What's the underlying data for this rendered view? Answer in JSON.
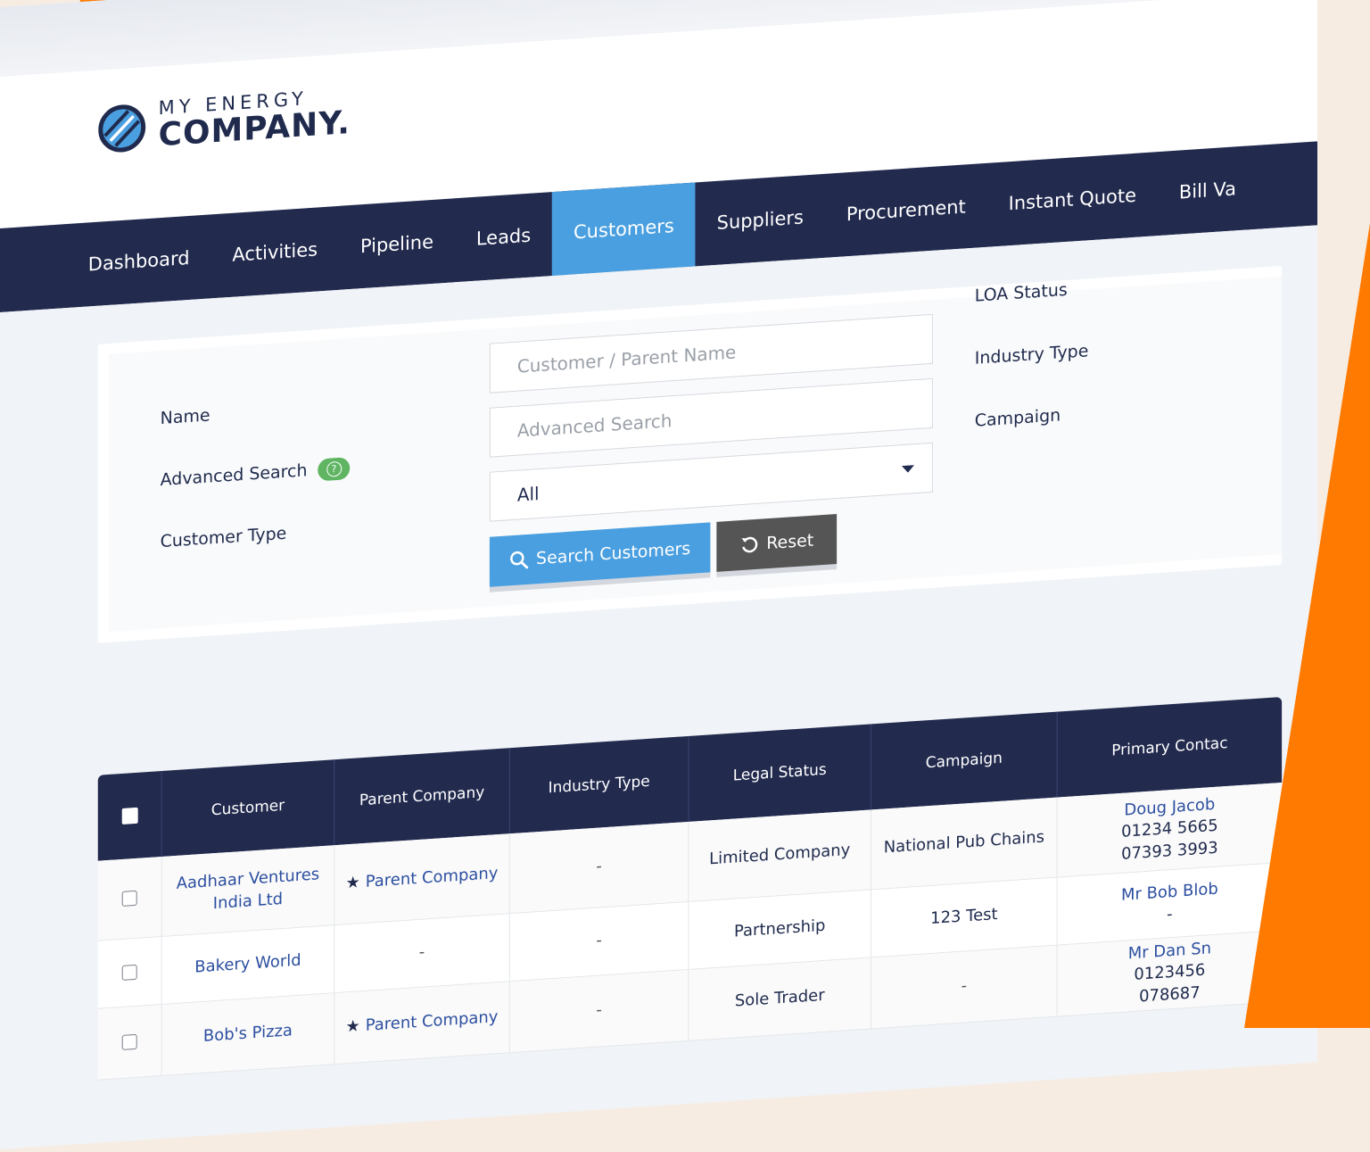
{
  "logo": {
    "small": "MY ENERGY",
    "big": "COMPANY."
  },
  "nav": {
    "items": [
      {
        "label": "Dashboard"
      },
      {
        "label": "Activities"
      },
      {
        "label": "Pipeline"
      },
      {
        "label": "Leads"
      },
      {
        "label": "Customers",
        "active": true
      },
      {
        "label": "Suppliers"
      },
      {
        "label": "Procurement"
      },
      {
        "label": "Instant Quote"
      },
      {
        "label": "Bill Va"
      }
    ]
  },
  "filter": {
    "name_label": "Name",
    "advanced_label": "Advanced Search",
    "customer_type_label": "Customer Type",
    "name_placeholder": "Customer / Parent Name",
    "advanced_placeholder": "Advanced Search",
    "customer_type_value": "All",
    "loa_status_label": "LOA Status",
    "industry_type_label": "Industry Type",
    "campaign_label": "Campaign",
    "search_button": "Search Customers",
    "reset_button": "Reset"
  },
  "table": {
    "headers": [
      "Customer",
      "Parent Company",
      "Industry Type",
      "Legal Status",
      "Campaign",
      "Primary Contac"
    ],
    "rows": [
      {
        "customer": "Aadhaar Ventures India Ltd",
        "parent": "Parent Company",
        "industry": "-",
        "legal": "Limited Company",
        "campaign": "National Pub Chains",
        "contact": "Doug Jacob",
        "phone1": "01234 5665",
        "phone2": "07393 3993"
      },
      {
        "customer": "Bakery World",
        "parent": "-",
        "industry": "-",
        "legal": "Partnership",
        "campaign": "123 Test",
        "contact": "Mr Bob Blob",
        "phone1": "-",
        "phone2": ""
      },
      {
        "customer": "Bob's Pizza",
        "parent": "Parent Company",
        "industry": "-",
        "legal": "Sole Trader",
        "campaign": "-",
        "contact": "Mr Dan Sn",
        "phone1": "0123456",
        "phone2": "078687"
      }
    ]
  },
  "colors": {
    "navy": "#222a4e",
    "accent": "#4a9fe0",
    "orange": "#ff7a00",
    "help_green": "#5fb562"
  }
}
